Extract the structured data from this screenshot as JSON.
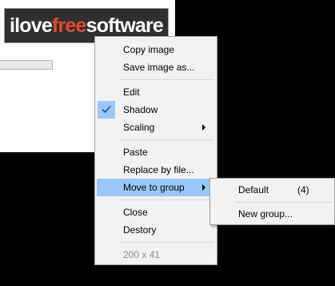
{
  "logo": {
    "part1": "ilove",
    "part2": "free",
    "part3": "software"
  },
  "colors": {
    "menu_bg": "#f2f2f2",
    "highlight": "#99c8f7",
    "logo_accent": "#e84a2c"
  },
  "context_menu": {
    "copy_image": "Copy image",
    "save_image_as": "Save image as...",
    "edit": "Edit",
    "shadow": "Shadow",
    "shadow_checked": true,
    "scaling": "Scaling",
    "paste": "Paste",
    "replace_by_file": "Replace by file...",
    "move_to_group": "Move to group",
    "close": "Close",
    "destory": "Destory",
    "dimensions": "200 x 41"
  },
  "submenu": {
    "default": "Default",
    "default_count": "(4)",
    "new_group": "New group..."
  },
  "icons": {
    "check": "check-icon",
    "submenu_arrow": "chevron-right-icon"
  }
}
